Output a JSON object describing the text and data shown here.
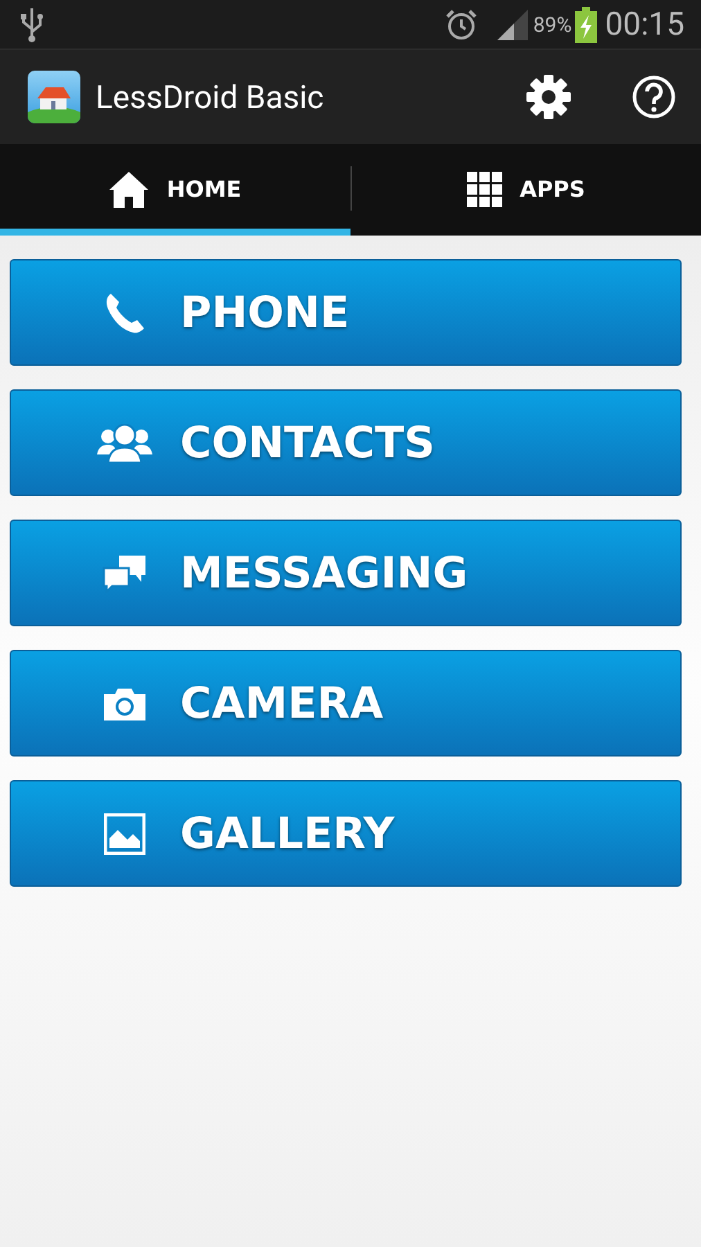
{
  "status_bar": {
    "battery": "89%",
    "time": "00:15"
  },
  "action_bar": {
    "title": "LessDroid Basic"
  },
  "tabs": [
    {
      "label": "HOME",
      "kind": "home",
      "selected": true
    },
    {
      "label": "APPS",
      "kind": "apps",
      "selected": false
    }
  ],
  "buttons": [
    {
      "label": "PHONE",
      "kind": "phone"
    },
    {
      "label": "CONTACTS",
      "kind": "contacts"
    },
    {
      "label": "MESSAGING",
      "kind": "messaging"
    },
    {
      "label": "CAMERA",
      "kind": "camera"
    },
    {
      "label": "GALLERY",
      "kind": "gallery"
    }
  ]
}
